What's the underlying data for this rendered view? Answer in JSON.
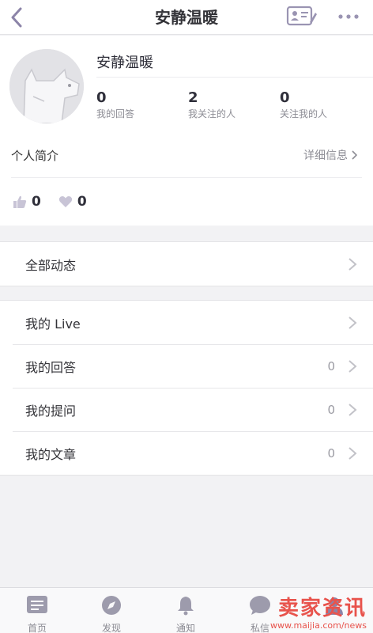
{
  "navbar": {
    "title": "安静温暖",
    "back_icon": "chevron-left-icon",
    "card_icon": "profile-card-edit-icon",
    "more_icon": "more-dots-icon"
  },
  "profile": {
    "username": "安静温暖",
    "stats": [
      {
        "value": "0",
        "label": "我的回答"
      },
      {
        "value": "2",
        "label": "我关注的人"
      },
      {
        "value": "0",
        "label": "关注我的人"
      }
    ],
    "bio_label": "个人简介",
    "bio_detail": "详细信息",
    "likes": "0",
    "thanks": "0"
  },
  "sections": {
    "activity": [
      {
        "label": "全部动态",
        "count": ""
      }
    ],
    "mine": [
      {
        "label": "我的 Live",
        "count": ""
      },
      {
        "label": "我的回答",
        "count": "0"
      },
      {
        "label": "我的提问",
        "count": "0"
      },
      {
        "label": "我的文章",
        "count": "0"
      }
    ]
  },
  "tabbar": {
    "items": [
      {
        "label": "首页",
        "icon": "home-list-icon"
      },
      {
        "label": "发现",
        "icon": "compass-icon"
      },
      {
        "label": "通知",
        "icon": "bell-icon"
      },
      {
        "label": "私信",
        "icon": "chat-bubble-icon"
      },
      {
        "label": "",
        "icon": "profile-icon"
      }
    ]
  },
  "watermark": {
    "text": "卖家资讯",
    "url": "www.maijia.com/news"
  },
  "colors": {
    "accent": "#8c84a8",
    "background": "#f2f2f4",
    "watermark": "#e8534c"
  }
}
